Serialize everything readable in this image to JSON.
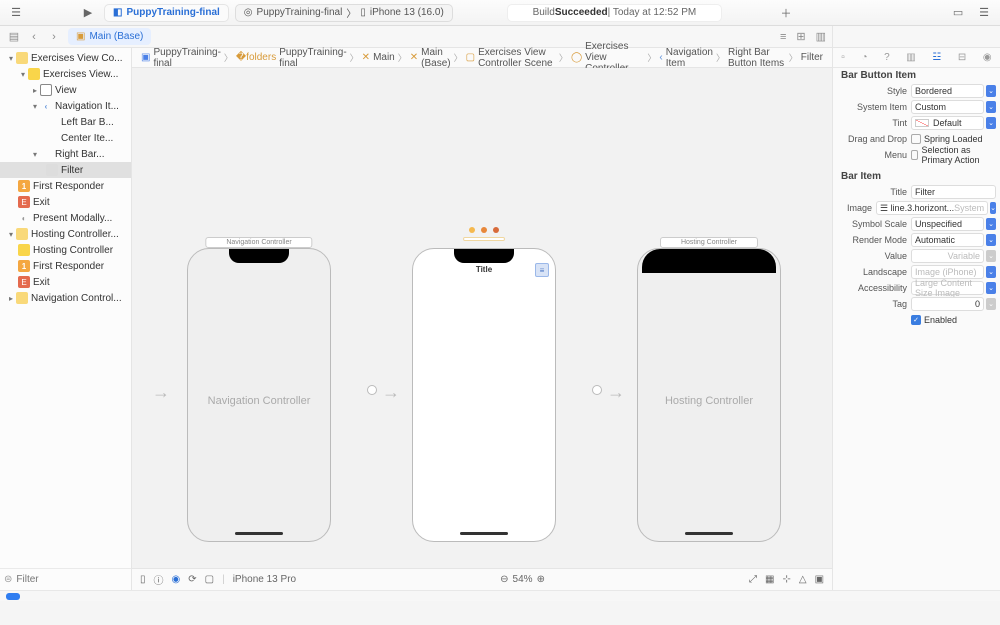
{
  "toolbar": {
    "project_name": "PuppyTraining-final",
    "scheme": "PuppyTraining-final",
    "device": "iPhone 13 (16.0)",
    "status_prefix": "Build ",
    "status_bold": "Succeeded",
    "status_suffix": " | Today at 12:52 PM"
  },
  "tab": {
    "active": "Main (Base)"
  },
  "jumpbar": {
    "crumbs": [
      "PuppyTraining-final",
      "PuppyTraining-final",
      "Main",
      "Main (Base)",
      "Exercises View Controller Scene",
      "Exercises View Controller",
      "Navigation Item",
      "Right Bar Button Items",
      "Filter"
    ]
  },
  "tree": {
    "n0": "Exercises View Co...",
    "n1": "Exercises View...",
    "n2": "View",
    "n3": "Navigation It...",
    "n4": "Left Bar B...",
    "n5": "Center Ite...",
    "n6": "Right Bar...",
    "n7": "Filter",
    "n8": "First Responder",
    "n9": "Exit",
    "n10": "Present Modally...",
    "n11": "Hosting Controller...",
    "n12": "Hosting Controller",
    "n13": "First Responder",
    "n14": "Exit",
    "n15": "Navigation Control..."
  },
  "sidebar_filter_placeholder": "Filter",
  "canvas": {
    "nav_label": "Navigation Controller",
    "nav_center": "Navigation Controller",
    "mid_title": "Title",
    "host_label": "Hosting Controller",
    "host_center": "Hosting Controller"
  },
  "bottom": {
    "device": "iPhone 13 Pro",
    "zoom": "54%"
  },
  "inspector": {
    "sec1": "Bar Button Item",
    "style_l": "Style",
    "style_v": "Bordered",
    "sys_l": "System Item",
    "sys_v": "Custom",
    "tint_l": "Tint",
    "tint_v": "Default",
    "drag_l": "Drag and Drop",
    "drag_v": "Spring Loaded",
    "menu_l": "Menu",
    "menu_v": "Selection as Primary Action",
    "sec2": "Bar Item",
    "title_l": "Title",
    "title_v": "Filter",
    "image_l": "Image",
    "image_v": "line.3.horizont...",
    "image_hint": "System",
    "sscale_l": "Symbol Scale",
    "sscale_v": "Unspecified",
    "rmode_l": "Render Mode",
    "rmode_v": "Automatic",
    "value_l": "Value",
    "value_v": "Variable",
    "land_l": "Landscape",
    "land_v": "Image (iPhone)",
    "acc_l": "Accessibility",
    "acc_v": "Large Content Size Image",
    "tag_l": "Tag",
    "tag_v": "0",
    "enabled": "Enabled"
  }
}
